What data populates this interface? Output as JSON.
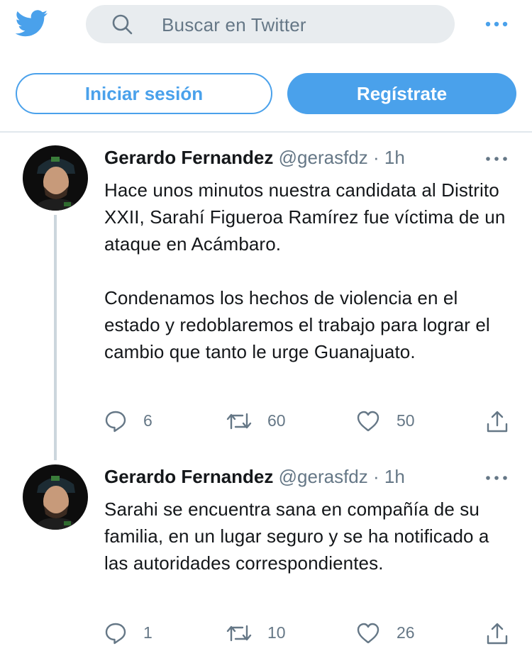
{
  "header": {
    "search_placeholder": "Buscar en Twitter",
    "logo_icon": "twitter-bird-icon",
    "more_icon": "more-horizontal-icon"
  },
  "auth": {
    "login_label": "Iniciar sesión",
    "signup_label": "Regístrate"
  },
  "colors": {
    "accent": "#4aa1eb",
    "secondary_text": "#657786",
    "divider": "#e1e8ed"
  },
  "tweets": [
    {
      "name": "Gerardo Fernandez",
      "handle": "@gerasfdz",
      "separator": "·",
      "time": "1h",
      "text": "Hace unos minutos nuestra candidata al Distrito XXII, Sarahí Figueroa Ramírez fue víctima de un ataque en Acámbaro.\n\nCondenamos los hechos de violencia en el estado y redoblaremos el trabajo para lograr el cambio que tanto le urge Guanajuato.",
      "replies": "6",
      "retweets": "60",
      "likes": "50"
    },
    {
      "name": "Gerardo Fernandez",
      "handle": "@gerasfdz",
      "separator": "·",
      "time": "1h",
      "text": "Sarahi se encuentra sana en compañía de su familia, en un lugar seguro y se ha notificado a las autoridades correspondientes.",
      "replies": "1",
      "retweets": "10",
      "likes": "26"
    }
  ]
}
